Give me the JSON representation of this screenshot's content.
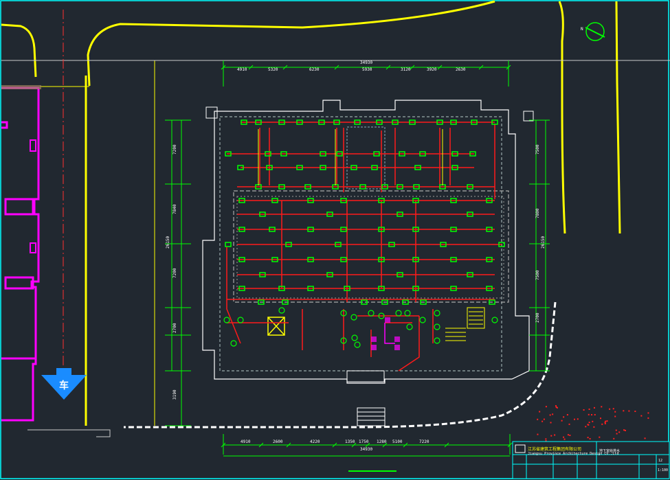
{
  "colors": {
    "background": "#212830",
    "frame": "#00ffff",
    "road": "#ffff00",
    "dimension": "#00ff00",
    "pipe": "#ff1a1a",
    "equipment": "#00ff00",
    "building_outline": "#ffffff",
    "neighbor_building": "#ff00ff",
    "arrow": "#1a8cff"
  },
  "dimensions": {
    "top_total": "34930",
    "top_segments": [
      "4910",
      "5320",
      "6230",
      "5930",
      "3120",
      "3920",
      "2630"
    ],
    "bottom_total": "34930",
    "bottom_segments": [
      "4910",
      "2600",
      "4220",
      "1350",
      "1750",
      "1280",
      "5100",
      "7220"
    ],
    "left_total": "26150",
    "left_segments": [
      "7200",
      "7840",
      "7200",
      "2700",
      "3190"
    ],
    "right_total": "26150",
    "right_segments": [
      "7500",
      "7800",
      "7500",
      "2700"
    ]
  },
  "labels": {
    "car_arrow": "车",
    "north_arrow": "N"
  },
  "title_block": {
    "company_cn": "江苏省建筑工程集团有限公司",
    "company_en": "Jiangsu Province Architecture Design Co.,Ltd",
    "drawing_title": "地下室给排水",
    "sheet_no": "12",
    "scale": "1:100"
  }
}
